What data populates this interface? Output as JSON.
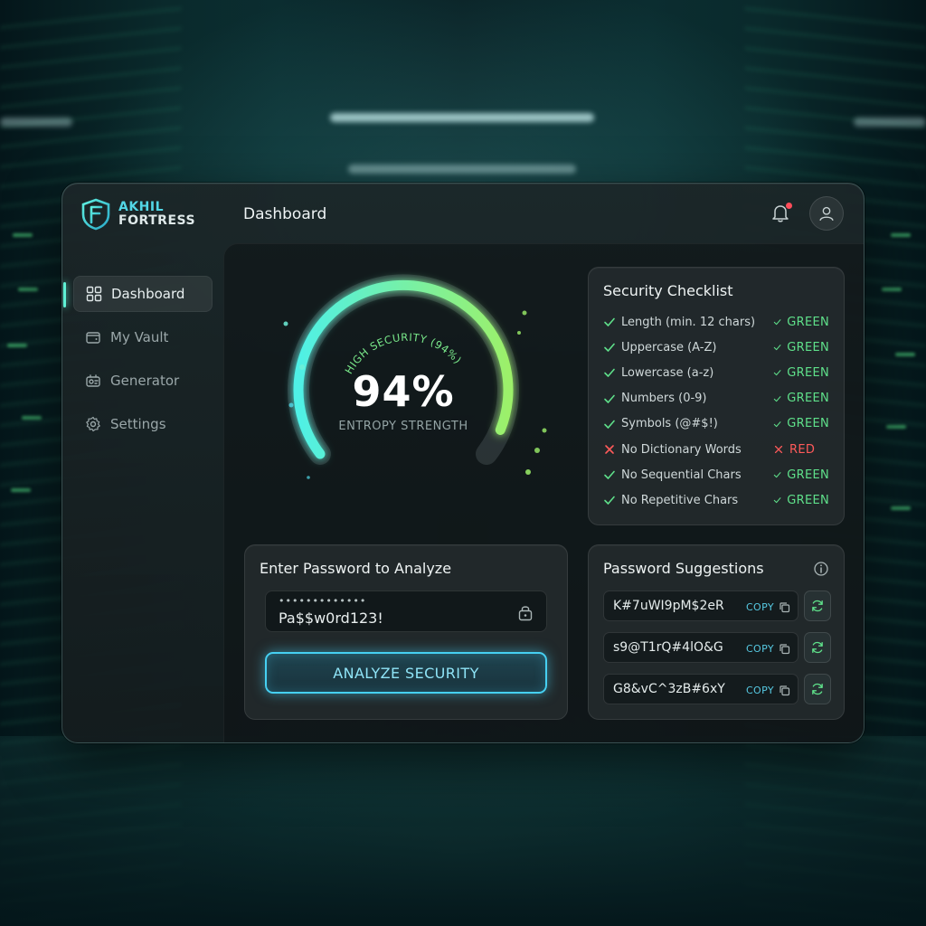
{
  "brand": {
    "line1": "AKHIL",
    "line2": "FORTRESS"
  },
  "header": {
    "title": "Dashboard"
  },
  "sidebar": {
    "items": [
      {
        "label": "Dashboard",
        "icon": "grid-icon",
        "active": true
      },
      {
        "label": "My Vault",
        "icon": "wallet-icon",
        "active": false
      },
      {
        "label": "Generator",
        "icon": "generator-icon",
        "active": false
      },
      {
        "label": "Settings",
        "icon": "gear-icon",
        "active": false
      }
    ]
  },
  "gauge": {
    "value": 94,
    "value_label": "94%",
    "arc_label": "HIGH SECURITY (94%)",
    "subtitle": "ENTROPY STRENGTH"
  },
  "checklist": {
    "title": "Security Checklist",
    "items": [
      {
        "label": "Length (min. 12 chars)",
        "status": "GREEN",
        "pass": true
      },
      {
        "label": "Uppercase (A-Z)",
        "status": "GREEN",
        "pass": true
      },
      {
        "label": "Lowercase (a-z)",
        "status": "GREEN",
        "pass": true
      },
      {
        "label": "Numbers (0-9)",
        "status": "GREEN",
        "pass": true
      },
      {
        "label": "Symbols (@#$!)",
        "status": "GREEN",
        "pass": true
      },
      {
        "label": "No Dictionary Words",
        "status": "RED",
        "pass": false
      },
      {
        "label": "No Sequential Chars",
        "status": "GREEN",
        "pass": true
      },
      {
        "label": "No Repetitive Chars",
        "status": "GREEN",
        "pass": true
      }
    ]
  },
  "analyze": {
    "title": "Enter Password to Analyze",
    "mask": "•••••••••••••",
    "value": "Pa$$w0rd123!",
    "button_label": "ANALYZE SECURITY"
  },
  "suggestions": {
    "title": "Password Suggestions",
    "copy_label": "COPY",
    "items": [
      "K#7uWI9pM$2eR",
      "s9@T1rQ#4lO&G",
      "G8&vC^3zB#6xY"
    ]
  },
  "colors": {
    "accent_cyan": "#46d0f2",
    "accent_green": "#5fe08a",
    "danger_red": "#ff5a5a",
    "gauge_start": "#4ff0e6",
    "gauge_end": "#9cf06a"
  }
}
